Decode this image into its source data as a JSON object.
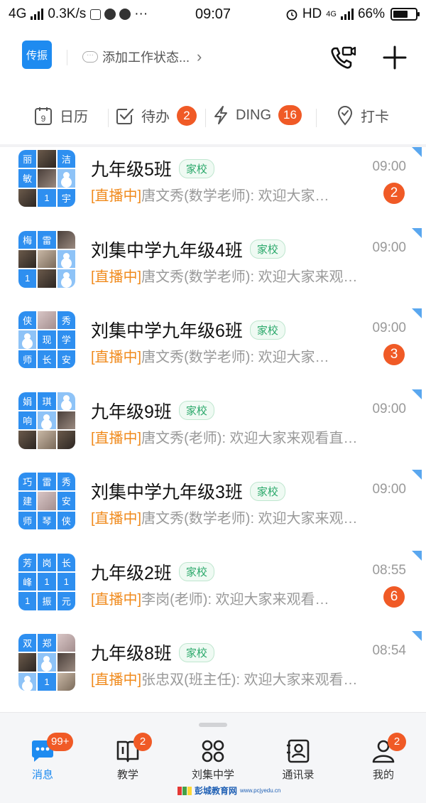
{
  "status_bar": {
    "network": "4G",
    "speed": "0.3K/s",
    "time": "09:07",
    "hd": "HD",
    "net2": "4G",
    "battery": "66%",
    "battery_level": 0.66
  },
  "header": {
    "chuanzhen_label": "传振",
    "status_prompt": "添加工作状态..."
  },
  "quick_bar": {
    "calendar": {
      "label": "日历",
      "icon_num": "9"
    },
    "todo": {
      "label": "待办",
      "badge": "2"
    },
    "ding": {
      "label": "DING",
      "badge": "16"
    },
    "punch": {
      "label": "打卡"
    }
  },
  "colors": {
    "accent": "#1e8bf0",
    "badge": "#f05a26",
    "live": "#f08a1c",
    "tag_green": "#2aa86a"
  },
  "conversations": [
    {
      "title": "九年级5班",
      "tag": "家校",
      "time": "09:00",
      "live": "[直播中]",
      "preview": "唐文秀(数学老师): 欢迎大家…",
      "unread": "2",
      "avatar": [
        {
          "t": "丽"
        },
        {
          "photo": "p1"
        },
        {
          "t": "洁"
        },
        {
          "t": "敏"
        },
        {
          "photo": "p3"
        },
        {
          "person": true
        },
        {
          "photo": "p1"
        },
        {
          "t": "1"
        },
        {
          "t": "宇"
        }
      ]
    },
    {
      "title": "刘集中学九年级4班",
      "tag": "家校",
      "time": "09:00",
      "live": "[直播中]",
      "preview": "唐文秀(数学老师): 欢迎大家来观…",
      "unread": "",
      "avatar": [
        {
          "t": "梅"
        },
        {
          "t": "雷"
        },
        {
          "photo": "p3"
        },
        {
          "photo": "p1"
        },
        {
          "photo": "p2"
        },
        {
          "person": true
        },
        {
          "t": "1"
        },
        {
          "photo": "p1"
        },
        {
          "person": true
        }
      ]
    },
    {
      "title": "刘集中学九年级6班",
      "tag": "家校",
      "time": "09:00",
      "live": "[直播中]",
      "preview": "唐文秀(数学老师): 欢迎大家…",
      "unread": "3",
      "avatar": [
        {
          "t": "侠"
        },
        {
          "photo": "p4"
        },
        {
          "t": "秀"
        },
        {
          "person": true
        },
        {
          "t": "现"
        },
        {
          "t": "学"
        },
        {
          "t": "师"
        },
        {
          "t": "长"
        },
        {
          "t": "安"
        }
      ]
    },
    {
      "title": "九年级9班",
      "tag": "家校",
      "time": "09:00",
      "live": "[直播中]",
      "preview": "唐文秀(老师): 欢迎大家来观看直…",
      "unread": "",
      "avatar": [
        {
          "t": "娟"
        },
        {
          "t": "琪"
        },
        {
          "person": true
        },
        {
          "t": "响"
        },
        {
          "person": true
        },
        {
          "photo": "p3"
        },
        {
          "photo": "p1"
        },
        {
          "photo": "p2"
        },
        {
          "photo": "p1"
        }
      ]
    },
    {
      "title": "刘集中学九年级3班",
      "tag": "家校",
      "time": "09:00",
      "live": "[直播中]",
      "preview": "唐文秀(数学老师): 欢迎大家来观…",
      "unread": "",
      "avatar": [
        {
          "t": "巧"
        },
        {
          "t": "雷"
        },
        {
          "t": "秀"
        },
        {
          "t": "建"
        },
        {
          "photo": "p4"
        },
        {
          "t": "安"
        },
        {
          "t": "师"
        },
        {
          "t": "琴"
        },
        {
          "t": "侠"
        }
      ]
    },
    {
      "title": "九年级2班",
      "tag": "家校",
      "time": "08:55",
      "live": "[直播中]",
      "preview": "李岗(老师): 欢迎大家来观看…",
      "unread": "6",
      "avatar": [
        {
          "t": "芳"
        },
        {
          "t": "岗"
        },
        {
          "t": "长"
        },
        {
          "t": "峰"
        },
        {
          "t": "1"
        },
        {
          "t": "1"
        },
        {
          "t": "1"
        },
        {
          "t": "振"
        },
        {
          "t": "元"
        }
      ]
    },
    {
      "title": "九年级8班",
      "tag": "家校",
      "time": "08:54",
      "live": "[直播中]",
      "preview": "张忠双(班主任): 欢迎大家来观看…",
      "unread": "",
      "avatar": [
        {
          "t": "双"
        },
        {
          "t": "郑"
        },
        {
          "photo": "p4"
        },
        {
          "photo": "p1"
        },
        {
          "person": true
        },
        {
          "photo": "p3"
        },
        {
          "person": true
        },
        {
          "t": "1"
        },
        {
          "photo": "p2"
        }
      ]
    }
  ],
  "tab_bar": {
    "tabs": [
      {
        "label": "消息",
        "badge": "99+",
        "icon": "message-icon",
        "active": true
      },
      {
        "label": "教学",
        "badge": "2",
        "icon": "book-icon",
        "active": false
      },
      {
        "label": "刘集中学",
        "badge": "",
        "icon": "grid-icon",
        "active": false
      },
      {
        "label": "通讯录",
        "badge": "",
        "icon": "contacts-icon",
        "active": false
      },
      {
        "label": "我的",
        "badge": "2",
        "icon": "profile-icon",
        "active": false
      }
    ]
  },
  "watermark": {
    "text": "彭城教育网",
    "sub": "www.pcjyedu.cn"
  }
}
